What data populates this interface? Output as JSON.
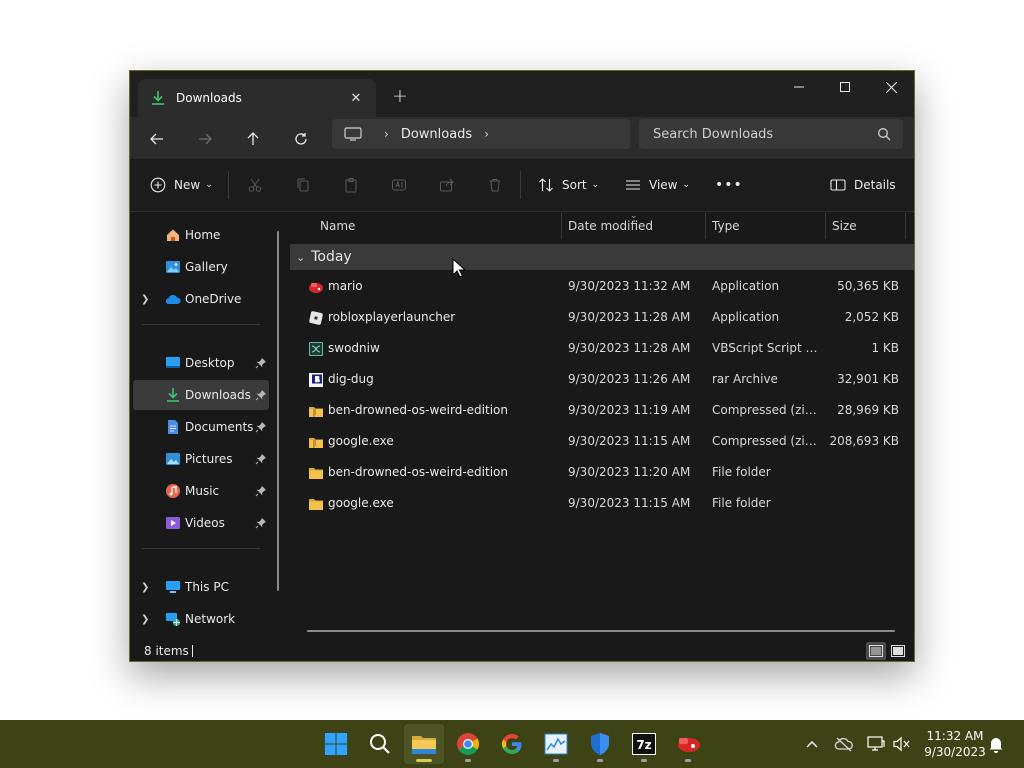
{
  "window": {
    "tab_title": "Downloads",
    "new_tab_symbol": "+",
    "tab_close_symbol": "✕"
  },
  "address": {
    "location": "Downloads",
    "search_placeholder": "Search Downloads"
  },
  "toolbar": {
    "new_label": "New",
    "sort_label": "Sort",
    "view_label": "View",
    "more_label": "•••",
    "details_label": "Details"
  },
  "sidebar": {
    "items": [
      {
        "label": "Home",
        "icon": "home-icon"
      },
      {
        "label": "Gallery",
        "icon": "gallery-icon"
      },
      {
        "label": "OneDrive",
        "icon": "cloud-icon"
      },
      {
        "label": "Desktop",
        "icon": "desktop-icon"
      },
      {
        "label": "Downloads",
        "icon": "download-icon"
      },
      {
        "label": "Documents",
        "icon": "documents-icon"
      },
      {
        "label": "Pictures",
        "icon": "pictures-icon"
      },
      {
        "label": "Music",
        "icon": "music-icon"
      },
      {
        "label": "Videos",
        "icon": "videos-icon"
      },
      {
        "label": "This PC",
        "icon": "pc-icon"
      },
      {
        "label": "Network",
        "icon": "network-icon"
      }
    ]
  },
  "columns": {
    "name": "Name",
    "date": "Date modified",
    "type": "Type",
    "size": "Size"
  },
  "group": {
    "label": "Today"
  },
  "files": [
    {
      "name": "mario",
      "date": "9/30/2023 11:32 AM",
      "type": "Application",
      "size": "50,365 KB",
      "icon": "app-red-icon"
    },
    {
      "name": "robloxplayerlauncher",
      "date": "9/30/2023 11:28 AM",
      "type": "Application",
      "size": "2,052 KB",
      "icon": "roblox-icon"
    },
    {
      "name": "swodniw",
      "date": "9/30/2023 11:28 AM",
      "type": "VBScript Script File",
      "size": "1 KB",
      "icon": "script-icon"
    },
    {
      "name": "dig-dug",
      "date": "9/30/2023 11:26 AM",
      "type": "rar Archive",
      "size": "32,901 KB",
      "icon": "rar-icon"
    },
    {
      "name": "ben-drowned-os-weird-edition",
      "date": "9/30/2023 11:19 AM",
      "type": "Compressed (zipped) Folder",
      "size": "28,969 KB",
      "icon": "zip-folder-icon"
    },
    {
      "name": "google.exe",
      "date": "9/30/2023 11:15 AM",
      "type": "Compressed (zipped) Folder",
      "size": "208,693 KB",
      "icon": "zip-folder-icon"
    },
    {
      "name": "ben-drowned-os-weird-edition",
      "date": "9/30/2023 11:20 AM",
      "type": "File folder",
      "size": "",
      "icon": "folder-icon"
    },
    {
      "name": "google.exe",
      "date": "9/30/2023 11:15 AM",
      "type": "File folder",
      "size": "",
      "icon": "folder-icon"
    }
  ],
  "status": {
    "item_count": "8 items"
  },
  "taskbar": {
    "time": "11:32 AM",
    "date": "9/30/2023",
    "apps": [
      "start",
      "search",
      "file-explorer",
      "chrome",
      "google",
      "task-manager",
      "windows-security",
      "7zip",
      "mario"
    ]
  },
  "colors": {
    "accent_green": "#3ec46d",
    "folder_yellow": "#f2c14e",
    "taskbar_bg": "#3e4316",
    "window_border": "#6b6a2a"
  }
}
